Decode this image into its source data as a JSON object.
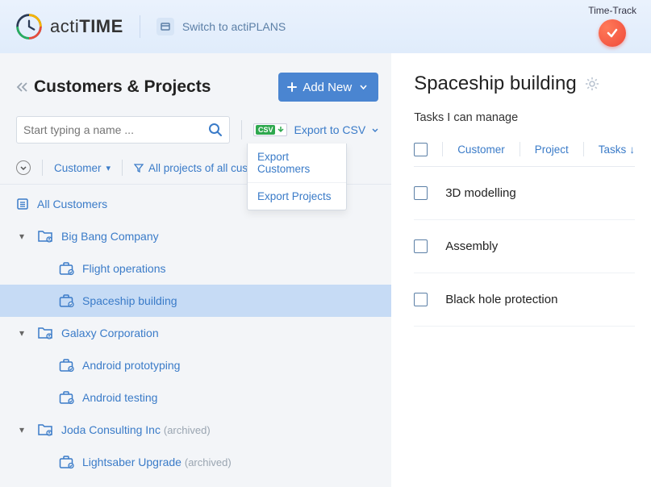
{
  "brand": {
    "name_light": "acti",
    "name_bold": "TIME"
  },
  "switch_link": "Switch to actiPLANS",
  "time_track_label": "Time-Track",
  "left": {
    "title": "Customers & Projects",
    "add_new": "Add New",
    "search_placeholder": "Start typing a name ...",
    "export_label": "Export to CSV",
    "export_menu": [
      "Export Customers",
      "Export Projects"
    ],
    "filter_customer": "Customer",
    "filter_projects": "All projects of all customers"
  },
  "tree": {
    "all_label": "All Customers",
    "customers": [
      {
        "name": "Big Bang Company",
        "projects": [
          {
            "name": "Flight operations"
          },
          {
            "name": "Spaceship building",
            "selected": true
          }
        ]
      },
      {
        "name": "Galaxy Corporation",
        "projects": [
          {
            "name": "Android prototyping"
          },
          {
            "name": "Android testing"
          }
        ]
      },
      {
        "name": "Joda Consulting Inc",
        "archived": true,
        "projects": [
          {
            "name": "Lightsaber Upgrade",
            "archived": true
          }
        ]
      }
    ]
  },
  "right": {
    "project_title": "Spaceship building",
    "subtitle": "Tasks I can manage",
    "columns": {
      "customer": "Customer",
      "project": "Project",
      "tasks": "Tasks"
    },
    "tasks": [
      "3D modelling",
      "Assembly",
      "Black hole protection"
    ]
  },
  "archived_suffix": "(archived)"
}
